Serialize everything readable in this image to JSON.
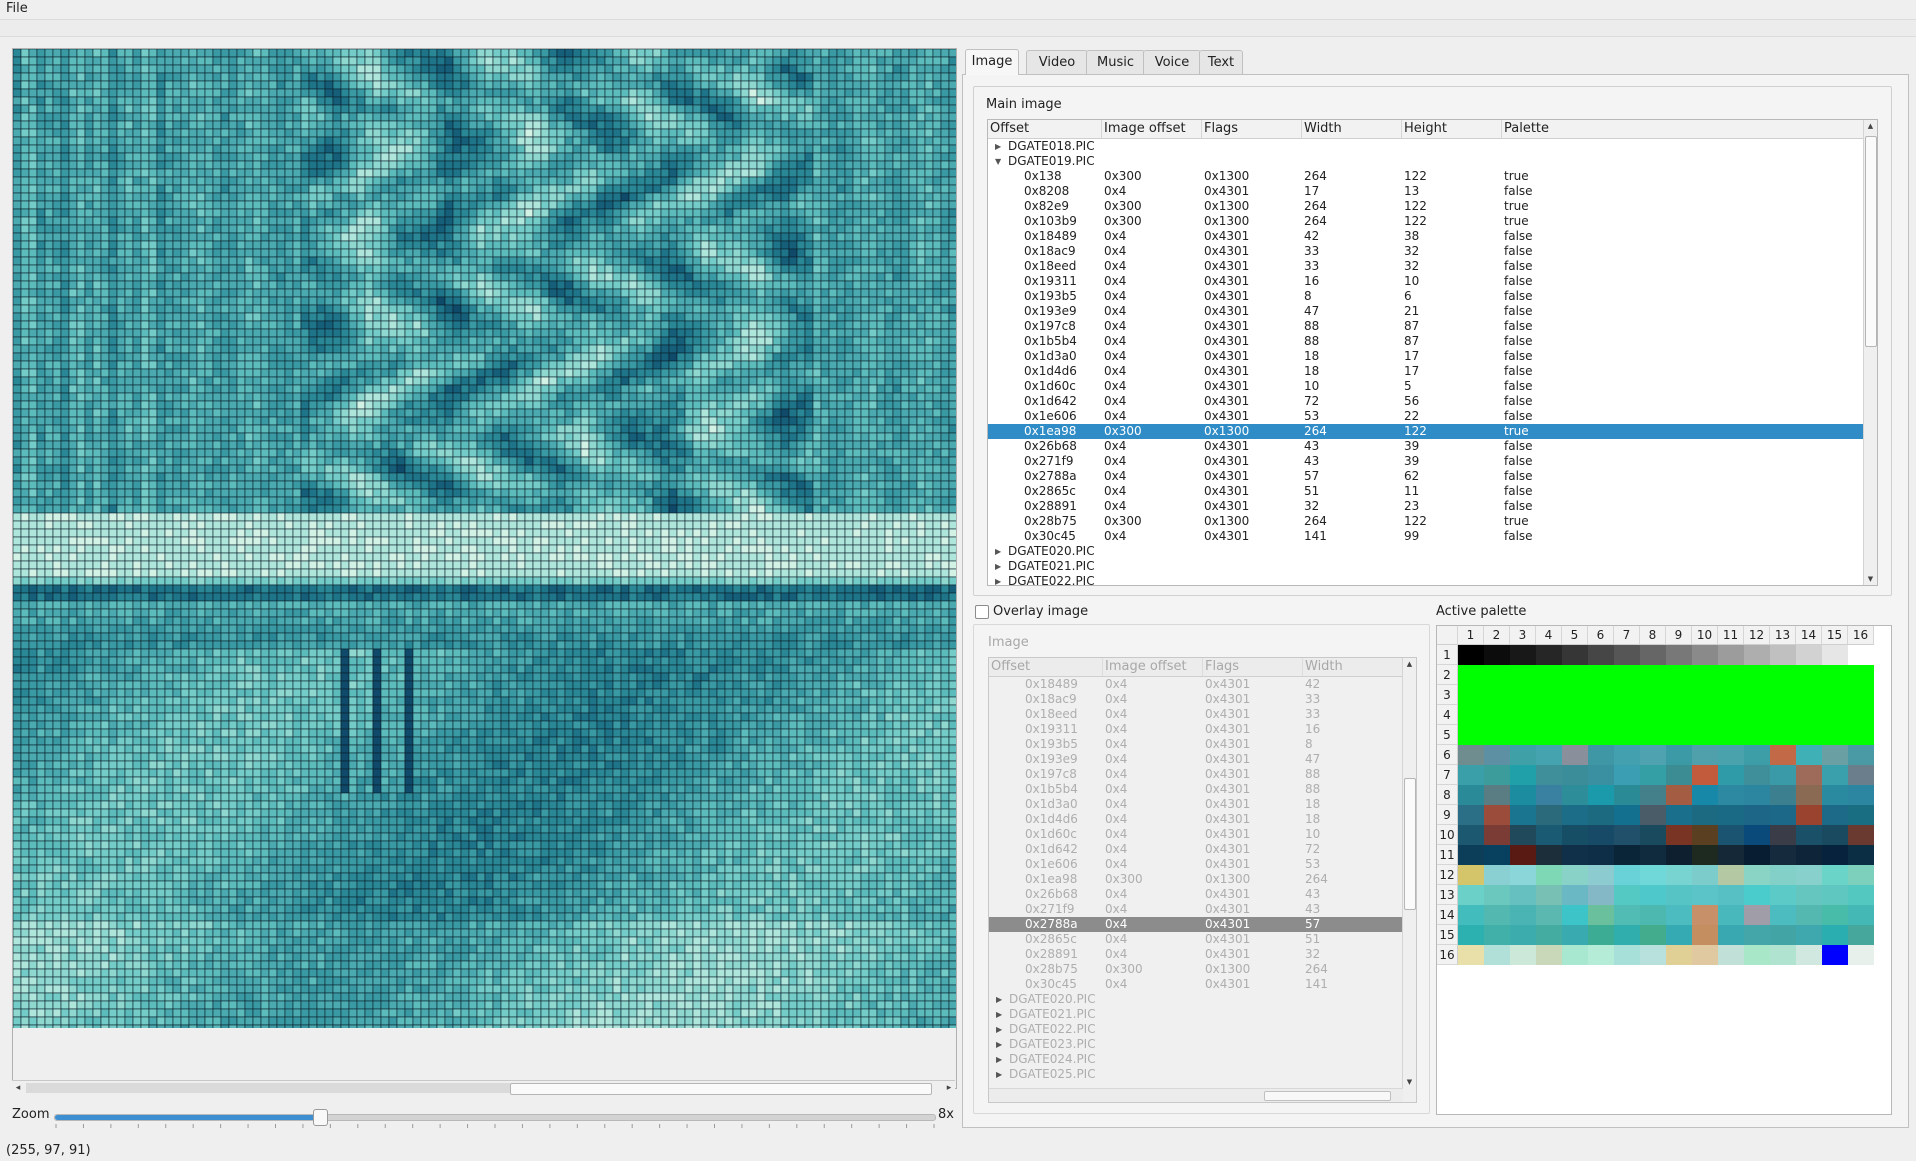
{
  "menu": {
    "file": "File"
  },
  "status": {
    "rgb": "(255, 97, 91)"
  },
  "zoom": {
    "label": "Zoom",
    "value_label": "8x",
    "level_fraction": 0.3
  },
  "tabs": [
    {
      "label": "Image",
      "active": true
    },
    {
      "label": "Video",
      "active": false
    },
    {
      "label": "Music",
      "active": false
    },
    {
      "label": "Voice",
      "active": false
    },
    {
      "label": "Text",
      "active": false
    }
  ],
  "main_image": {
    "title": "Main image",
    "columns": [
      "Offset",
      "Image offset",
      "Flags",
      "Width",
      "Height",
      "Palette"
    ],
    "rows": [
      {
        "type": "group",
        "name": "DGATE018.PIC",
        "expanded": false
      },
      {
        "type": "group",
        "name": "DGATE019.PIC",
        "expanded": true
      },
      {
        "type": "item",
        "cells": [
          "0x138",
          "0x300",
          "0x1300",
          "264",
          "122",
          "true"
        ]
      },
      {
        "type": "item",
        "cells": [
          "0x8208",
          "0x4",
          "0x4301",
          "17",
          "13",
          "false"
        ]
      },
      {
        "type": "item",
        "cells": [
          "0x82e9",
          "0x300",
          "0x1300",
          "264",
          "122",
          "true"
        ]
      },
      {
        "type": "item",
        "cells": [
          "0x103b9",
          "0x300",
          "0x1300",
          "264",
          "122",
          "true"
        ]
      },
      {
        "type": "item",
        "cells": [
          "0x18489",
          "0x4",
          "0x4301",
          "42",
          "38",
          "false"
        ]
      },
      {
        "type": "item",
        "cells": [
          "0x18ac9",
          "0x4",
          "0x4301",
          "33",
          "32",
          "false"
        ]
      },
      {
        "type": "item",
        "cells": [
          "0x18eed",
          "0x4",
          "0x4301",
          "33",
          "32",
          "false"
        ]
      },
      {
        "type": "item",
        "cells": [
          "0x19311",
          "0x4",
          "0x4301",
          "16",
          "10",
          "false"
        ]
      },
      {
        "type": "item",
        "cells": [
          "0x193b5",
          "0x4",
          "0x4301",
          "8",
          "6",
          "false"
        ]
      },
      {
        "type": "item",
        "cells": [
          "0x193e9",
          "0x4",
          "0x4301",
          "47",
          "21",
          "false"
        ]
      },
      {
        "type": "item",
        "cells": [
          "0x197c8",
          "0x4",
          "0x4301",
          "88",
          "87",
          "false"
        ]
      },
      {
        "type": "item",
        "cells": [
          "0x1b5b4",
          "0x4",
          "0x4301",
          "88",
          "87",
          "false"
        ]
      },
      {
        "type": "item",
        "cells": [
          "0x1d3a0",
          "0x4",
          "0x4301",
          "18",
          "17",
          "false"
        ]
      },
      {
        "type": "item",
        "cells": [
          "0x1d4d6",
          "0x4",
          "0x4301",
          "18",
          "17",
          "false"
        ]
      },
      {
        "type": "item",
        "cells": [
          "0x1d60c",
          "0x4",
          "0x4301",
          "10",
          "5",
          "false"
        ]
      },
      {
        "type": "item",
        "cells": [
          "0x1d642",
          "0x4",
          "0x4301",
          "72",
          "56",
          "false"
        ]
      },
      {
        "type": "item",
        "cells": [
          "0x1e606",
          "0x4",
          "0x4301",
          "53",
          "22",
          "false"
        ]
      },
      {
        "type": "item",
        "cells": [
          "0x1ea98",
          "0x300",
          "0x1300",
          "264",
          "122",
          "true"
        ],
        "selected": true
      },
      {
        "type": "item",
        "cells": [
          "0x26b68",
          "0x4",
          "0x4301",
          "43",
          "39",
          "false"
        ]
      },
      {
        "type": "item",
        "cells": [
          "0x271f9",
          "0x4",
          "0x4301",
          "43",
          "39",
          "false"
        ]
      },
      {
        "type": "item",
        "cells": [
          "0x2788a",
          "0x4",
          "0x4301",
          "57",
          "62",
          "false"
        ]
      },
      {
        "type": "item",
        "cells": [
          "0x2865c",
          "0x4",
          "0x4301",
          "51",
          "11",
          "false"
        ]
      },
      {
        "type": "item",
        "cells": [
          "0x28891",
          "0x4",
          "0x4301",
          "32",
          "23",
          "false"
        ]
      },
      {
        "type": "item",
        "cells": [
          "0x28b75",
          "0x300",
          "0x1300",
          "264",
          "122",
          "true"
        ]
      },
      {
        "type": "item",
        "cells": [
          "0x30c45",
          "0x4",
          "0x4301",
          "141",
          "99",
          "false"
        ]
      },
      {
        "type": "group",
        "name": "DGATE020.PIC",
        "expanded": false
      },
      {
        "type": "group",
        "name": "DGATE021.PIC",
        "expanded": false
      },
      {
        "type": "group",
        "name": "DGATE022.PIC",
        "expanded": false
      }
    ]
  },
  "overlay": {
    "checkbox_label": "Overlay image",
    "checked": false,
    "group_title": "Image",
    "columns": [
      "Offset",
      "Image offset",
      "Flags",
      "Width"
    ],
    "rows": [
      {
        "type": "item",
        "cells": [
          "0x18489",
          "0x4",
          "0x4301",
          "42"
        ]
      },
      {
        "type": "item",
        "cells": [
          "0x18ac9",
          "0x4",
          "0x4301",
          "33"
        ]
      },
      {
        "type": "item",
        "cells": [
          "0x18eed",
          "0x4",
          "0x4301",
          "33"
        ]
      },
      {
        "type": "item",
        "cells": [
          "0x19311",
          "0x4",
          "0x4301",
          "16"
        ]
      },
      {
        "type": "item",
        "cells": [
          "0x193b5",
          "0x4",
          "0x4301",
          "8"
        ]
      },
      {
        "type": "item",
        "cells": [
          "0x193e9",
          "0x4",
          "0x4301",
          "47"
        ]
      },
      {
        "type": "item",
        "cells": [
          "0x197c8",
          "0x4",
          "0x4301",
          "88"
        ]
      },
      {
        "type": "item",
        "cells": [
          "0x1b5b4",
          "0x4",
          "0x4301",
          "88"
        ]
      },
      {
        "type": "item",
        "cells": [
          "0x1d3a0",
          "0x4",
          "0x4301",
          "18"
        ]
      },
      {
        "type": "item",
        "cells": [
          "0x1d4d6",
          "0x4",
          "0x4301",
          "18"
        ]
      },
      {
        "type": "item",
        "cells": [
          "0x1d60c",
          "0x4",
          "0x4301",
          "10"
        ]
      },
      {
        "type": "item",
        "cells": [
          "0x1d642",
          "0x4",
          "0x4301",
          "72"
        ]
      },
      {
        "type": "item",
        "cells": [
          "0x1e606",
          "0x4",
          "0x4301",
          "53"
        ]
      },
      {
        "type": "item",
        "cells": [
          "0x1ea98",
          "0x300",
          "0x1300",
          "264"
        ]
      },
      {
        "type": "item",
        "cells": [
          "0x26b68",
          "0x4",
          "0x4301",
          "43"
        ]
      },
      {
        "type": "item",
        "cells": [
          "0x271f9",
          "0x4",
          "0x4301",
          "43"
        ]
      },
      {
        "type": "item",
        "cells": [
          "0x2788a",
          "0x4",
          "0x4301",
          "57"
        ],
        "selected": true
      },
      {
        "type": "item",
        "cells": [
          "0x2865c",
          "0x4",
          "0x4301",
          "51"
        ]
      },
      {
        "type": "item",
        "cells": [
          "0x28891",
          "0x4",
          "0x4301",
          "32"
        ]
      },
      {
        "type": "item",
        "cells": [
          "0x28b75",
          "0x300",
          "0x1300",
          "264"
        ]
      },
      {
        "type": "item",
        "cells": [
          "0x30c45",
          "0x4",
          "0x4301",
          "141"
        ]
      },
      {
        "type": "group",
        "name": "DGATE020.PIC"
      },
      {
        "type": "group",
        "name": "DGATE021.PIC"
      },
      {
        "type": "group",
        "name": "DGATE022.PIC"
      },
      {
        "type": "group",
        "name": "DGATE023.PIC"
      },
      {
        "type": "group",
        "name": "DGATE024.PIC"
      },
      {
        "type": "group",
        "name": "DGATE025.PIC"
      }
    ]
  },
  "palette": {
    "title": "Active palette",
    "column_labels": [
      "1",
      "2",
      "3",
      "4",
      "5",
      "6",
      "7",
      "8",
      "9",
      "10",
      "11",
      "12",
      "13",
      "14",
      "15",
      "16"
    ],
    "row_labels": [
      "1",
      "2",
      "3",
      "4",
      "5",
      "6",
      "7",
      "8",
      "9",
      "10",
      "11",
      "12",
      "13",
      "14",
      "15",
      "16"
    ],
    "colors": [
      [
        "#000000",
        "#0c0c0c",
        "#181818",
        "#262626",
        "#363636",
        "#464646",
        "#565656",
        "#666666",
        "#787878",
        "#8a8a8a",
        "#9c9c9c",
        "#aeaeae",
        "#c0c0c0",
        "#d2d2d2",
        "#e6e6e6",
        "#ffffff"
      ],
      [
        "#00ff00",
        "#00ff00",
        "#00ff00",
        "#00ff00",
        "#00ff00",
        "#00ff00",
        "#00ff00",
        "#00ff00",
        "#00ff00",
        "#00ff00",
        "#00ff00",
        "#00ff00",
        "#00ff00",
        "#00ff00",
        "#00ff00",
        "#00ff00"
      ],
      [
        "#00ff00",
        "#00ff00",
        "#00ff00",
        "#00ff00",
        "#00ff00",
        "#00ff00",
        "#00ff00",
        "#00ff00",
        "#00ff00",
        "#00ff00",
        "#00ff00",
        "#00ff00",
        "#00ff00",
        "#00ff00",
        "#00ff00",
        "#00ff00"
      ],
      [
        "#00ff00",
        "#00ff00",
        "#00ff00",
        "#00ff00",
        "#00ff00",
        "#00ff00",
        "#00ff00",
        "#00ff00",
        "#00ff00",
        "#00ff00",
        "#00ff00",
        "#00ff00",
        "#00ff00",
        "#00ff00",
        "#00ff00",
        "#00ff00"
      ],
      [
        "#00ff00",
        "#00ff00",
        "#00ff00",
        "#00ff00",
        "#00ff00",
        "#00ff00",
        "#00ff00",
        "#00ff00",
        "#00ff00",
        "#00ff00",
        "#00ff00",
        "#00ff00",
        "#00ff00",
        "#00ff00",
        "#00ff00",
        "#00ff00"
      ],
      [
        "#6f8d8f",
        "#5e90a3",
        "#3fa0a8",
        "#45a3b0",
        "#8a8f9c",
        "#3f97a6",
        "#43a0ae",
        "#4fa3b0",
        "#3c9aa6",
        "#4fa0aa",
        "#4aa2ac",
        "#3d9ea8",
        "#c26a48",
        "#3fb0b5",
        "#6aa0a3",
        "#4a9aa6"
      ],
      [
        "#3a9fa8",
        "#3c9c9b",
        "#20a0a8",
        "#3e8f9a",
        "#3c8d9a",
        "#3a90a0",
        "#3c9eb2",
        "#34a0a6",
        "#3c8c94",
        "#c25a3c",
        "#2f9aa8",
        "#3f8f9a",
        "#3a9aa8",
        "#9e6a5a",
        "#3aa0ab",
        "#6b7e8c"
      ],
      [
        "#2a8a98",
        "#5a7c83",
        "#1c8da0",
        "#3a80a0",
        "#2d8e9a",
        "#1a9aaa",
        "#2a8a96",
        "#44808a",
        "#a45c42",
        "#1888a8",
        "#2d88a2",
        "#2c86a0",
        "#3c8090",
        "#8a6a52",
        "#2a8aa0",
        "#2c86a2"
      ],
      [
        "#2a6f86",
        "#9c4c3a",
        "#1a7690",
        "#2a6a7a",
        "#1c6e88",
        "#1c6a80",
        "#13708e",
        "#4a5c68",
        "#1a708c",
        "#1c6a82",
        "#1a6a86",
        "#1d6688",
        "#1c6888",
        "#9a4430",
        "#1c6a88",
        "#1a6e82"
      ],
      [
        "#1c5870",
        "#7a3c34",
        "#204a5c",
        "#1a5a72",
        "#164e66",
        "#174a66",
        "#20506a",
        "#1a4a5e",
        "#7a3424",
        "#5a4020",
        "#1a5470",
        "#0a4a7a",
        "#3a3c48",
        "#1a5068",
        "#1a4a60",
        "#6a3a30"
      ],
      [
        "#0c3e5a",
        "#084060",
        "#5a1a14",
        "#1c2e3a",
        "#10304a",
        "#0e2e48",
        "#0a2438",
        "#102a3e",
        "#0e2030",
        "#1e2a20",
        "#142838",
        "#081c32",
        "#162a3e",
        "#0e2438",
        "#06223c",
        "#0c2e44"
      ],
      [
        "#d4c46a",
        "#8ad0d2",
        "#8ad6d8",
        "#7ed8b6",
        "#88d2c8",
        "#8cccd0",
        "#68d2d8",
        "#70d8d8",
        "#78d4d0",
        "#7ccccc",
        "#b4c8a4",
        "#8ad4c6",
        "#82d0c8",
        "#88d0cc",
        "#6ad4c8",
        "#7cd0bc"
      ],
      [
        "#6ad0c8",
        "#6ac8be",
        "#66c0c0",
        "#78c0b4",
        "#6ab8c4",
        "#84b8c6",
        "#54c8c2",
        "#4ec8ca",
        "#56c4c4",
        "#5ac4c8",
        "#56c0c4",
        "#4acccc",
        "#5ccac6",
        "#64c6be",
        "#60c6c0",
        "#52c8c0"
      ],
      [
        "#42bcbc",
        "#52b8b0",
        "#4ab4b4",
        "#5ab8b0",
        "#3cc4c8",
        "#6ac09c",
        "#50bcb4",
        "#4cb8b0",
        "#4cbcc0",
        "#c89068",
        "#48b8bc",
        "#a09ca8",
        "#4cbcc0",
        "#54b8b0",
        "#48bca8",
        "#44b8b4"
      ],
      [
        "#2cb0b0",
        "#40b0a8",
        "#3cacac",
        "#44aca0",
        "#38aab0",
        "#3cac94",
        "#30aeae",
        "#42ac8c",
        "#36aab2",
        "#c48e60",
        "#3aa8b0",
        "#44a6a8",
        "#42a4a4",
        "#3ea8ae",
        "#2aaeb0",
        "#46a89c"
      ],
      [
        "#e8e0a8",
        "#b0e0d8",
        "#cce8d8",
        "#c8d8b8",
        "#a8e8d0",
        "#b4ecd8",
        "#a6e0d8",
        "#b8e0dc",
        "#e0d096",
        "#e0c8a0",
        "#c0e0d8",
        "#a8e8c8",
        "#b0e4d0",
        "#d0e8e0",
        "#0000ff",
        "#e8f0ec"
      ]
    ]
  },
  "canvas": {
    "palette_ramp": [
      "#0b2f4a",
      "#0f4a6a",
      "#165f7a",
      "#1e7488",
      "#2a8896",
      "#3a9aa4",
      "#4aaab0",
      "#5cbcbc",
      "#74ccc8",
      "#8ed8d0",
      "#aee6dc",
      "#d2f2e6"
    ]
  }
}
